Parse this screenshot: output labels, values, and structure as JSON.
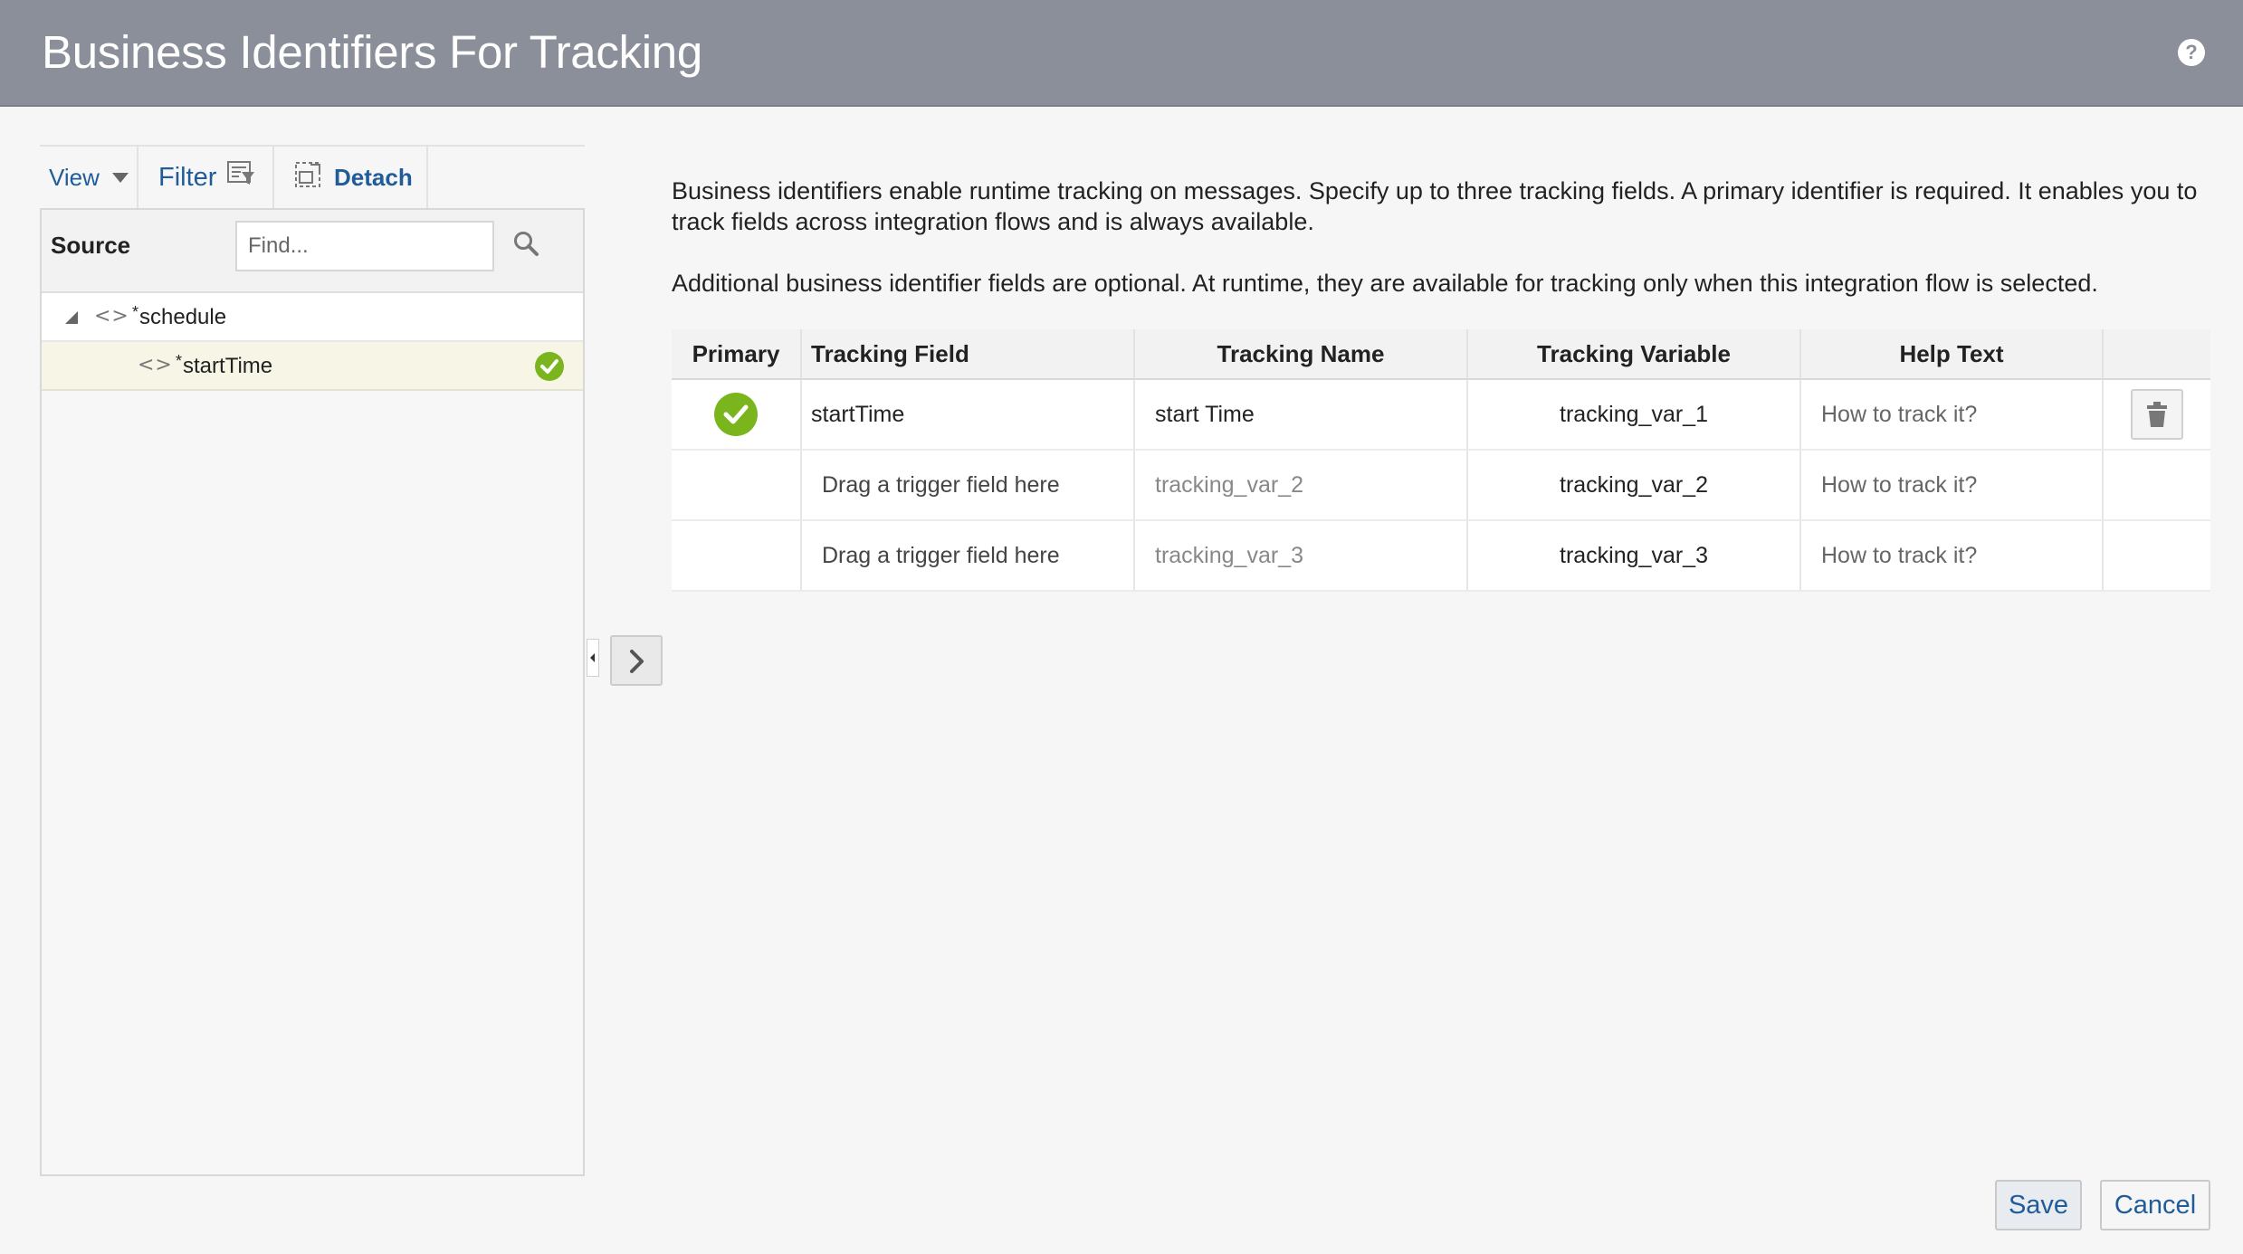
{
  "header": {
    "title": "Business Identifiers For Tracking",
    "help_icon": "?"
  },
  "toolbar": {
    "view_label": "View",
    "filter_label": "Filter",
    "detach_label": "Detach"
  },
  "source_panel": {
    "label": "Source",
    "find_placeholder": "Find...",
    "tree": [
      {
        "required_mark": "*",
        "label": "schedule"
      },
      {
        "required_mark": "*",
        "label": "startTime"
      }
    ]
  },
  "description": {
    "para1": "Business identifiers enable runtime tracking on messages. Specify up to three tracking fields. A primary identifier is required. It enables you to track fields across integration flows and is always available.",
    "para2": "Additional business identifier fields are optional. At runtime, they are available for tracking only when this integration flow is selected."
  },
  "table": {
    "headers": [
      "Primary",
      "Tracking Field",
      "Tracking Name",
      "Tracking Variable",
      "Help Text"
    ],
    "rows": [
      {
        "primary": true,
        "field": "startTime",
        "name": "start Time",
        "variable": "tracking_var_1",
        "help": "How to track it?"
      },
      {
        "primary": false,
        "field": "Drag a trigger field here",
        "name": "tracking_var_2",
        "variable": "tracking_var_2",
        "help": "How to track it?"
      },
      {
        "primary": false,
        "field": "Drag a trigger field here",
        "name": "tracking_var_3",
        "variable": "tracking_var_3",
        "help": "How to track it?"
      }
    ]
  },
  "footer": {
    "save_label": "Save",
    "cancel_label": "Cancel"
  },
  "colors": {
    "header_bg": "#8b8f9a",
    "link_blue": "#1f5c99",
    "success_green": "#7ab51d",
    "selected_row": "#f7f6e6"
  }
}
